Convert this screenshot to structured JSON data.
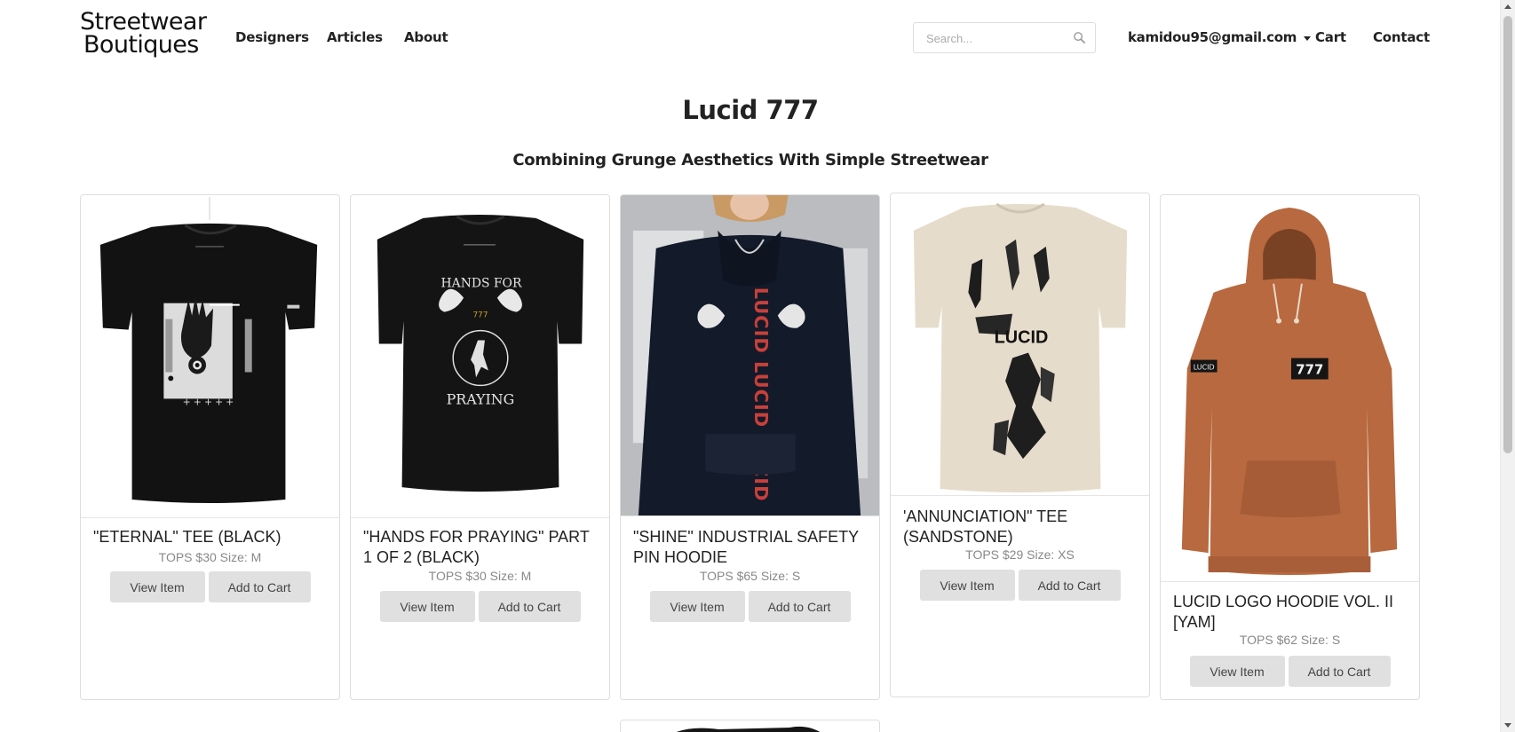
{
  "header": {
    "logo_line1": "Streetwear",
    "logo_line2": "Boutiques",
    "nav": [
      "Designers",
      "Articles",
      "About"
    ],
    "search_placeholder": "Search...",
    "user_email": "kamidou95@gmail.com",
    "cart_label": "Cart",
    "contact_label": "Contact"
  },
  "page": {
    "title": "Lucid 777",
    "subtitle": "Combining Grunge Aesthetics With Simple Streetwear"
  },
  "products": [
    {
      "title": "\"ETERNAL\" TEE (BLACK)",
      "meta": "TOPS $30 Size: M",
      "view_label": "View Item",
      "cart_label": "Add to Cart",
      "image_alt": "black t-shirt with hand and eye graphic"
    },
    {
      "title": "\"HANDS FOR PRAYING\" PART 1 OF 2 (BLACK)",
      "meta": "TOPS $30 Size: M",
      "view_label": "View Item",
      "cart_label": "Add to Cart",
      "image_alt": "black t-shirt with doves and praying figure",
      "print_top": "HANDS FOR",
      "print_bottom": "PRAYING",
      "print_mid": "777"
    },
    {
      "title": "\"SHINE\" INDUSTRIAL SAFETY PIN HOODIE",
      "meta": "TOPS $65 Size: S",
      "view_label": "View Item",
      "cart_label": "Add to Cart",
      "image_alt": "model wearing navy hoodie with red lucid print",
      "print_text": "LUCID LUCID LUCID"
    },
    {
      "title": "'ANNUNCIATION\" TEE (SANDSTONE)",
      "meta": "TOPS $29 Size: XS",
      "view_label": "View Item",
      "cart_label": "Add to Cart",
      "image_alt": "sandstone t-shirt with distressed print",
      "print_text": "LUCID"
    },
    {
      "title": "LUCID LOGO HOODIE VOL. II [YAM]",
      "meta": "TOPS $62 Size: S",
      "view_label": "View Item",
      "cart_label": "Add to Cart",
      "image_alt": "orange hoodie with 777 patch",
      "patch_text": "777",
      "sleeve_text": "LUCID"
    }
  ],
  "colors": {
    "button_bg": "#e0e0e0",
    "card_border": "#dddddd",
    "meta_text": "#888888",
    "hoodie_yam": "#b8693f",
    "tee_sand": "#e6dccb"
  }
}
